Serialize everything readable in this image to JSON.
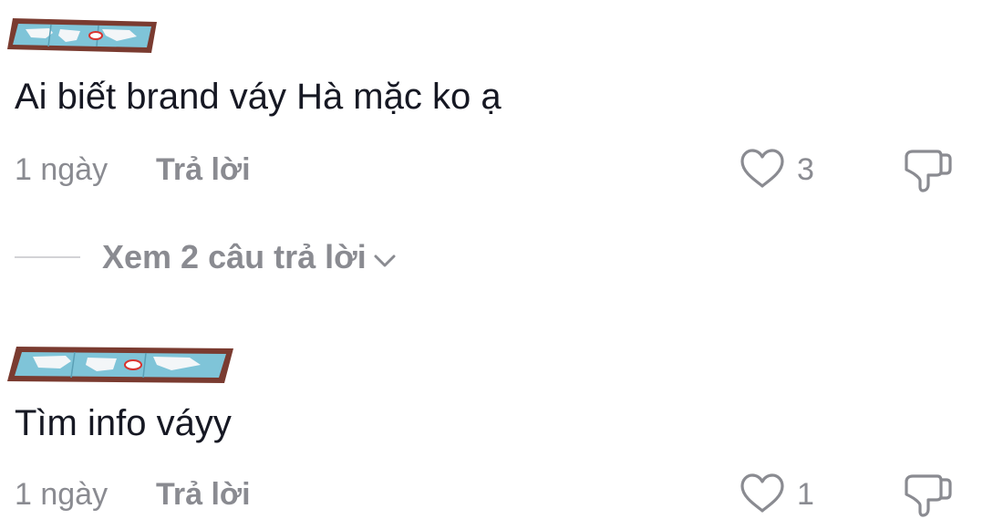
{
  "comments": [
    {
      "sticker_icon": "folded-map-sticker",
      "text": "Ai biết brand váy Hà mặc ko ạ",
      "time": "1 ngày",
      "reply_label": "Trả lời",
      "likes": "3",
      "view_replies_label": "Xem 2 câu trả lời"
    },
    {
      "sticker_icon": "folded-map-sticker",
      "text": "Tìm info váyy",
      "time": "1 ngày",
      "reply_label": "Trả lời",
      "likes": "1"
    }
  ],
  "colors": {
    "text": "#161823",
    "secondary": "#8a8b91",
    "divider": "#d3d3d6",
    "map_frame": "#7a3b30",
    "map_water": "#7fc4d8",
    "map_land": "#f3f6f8",
    "map_pin": "#d9332e"
  }
}
